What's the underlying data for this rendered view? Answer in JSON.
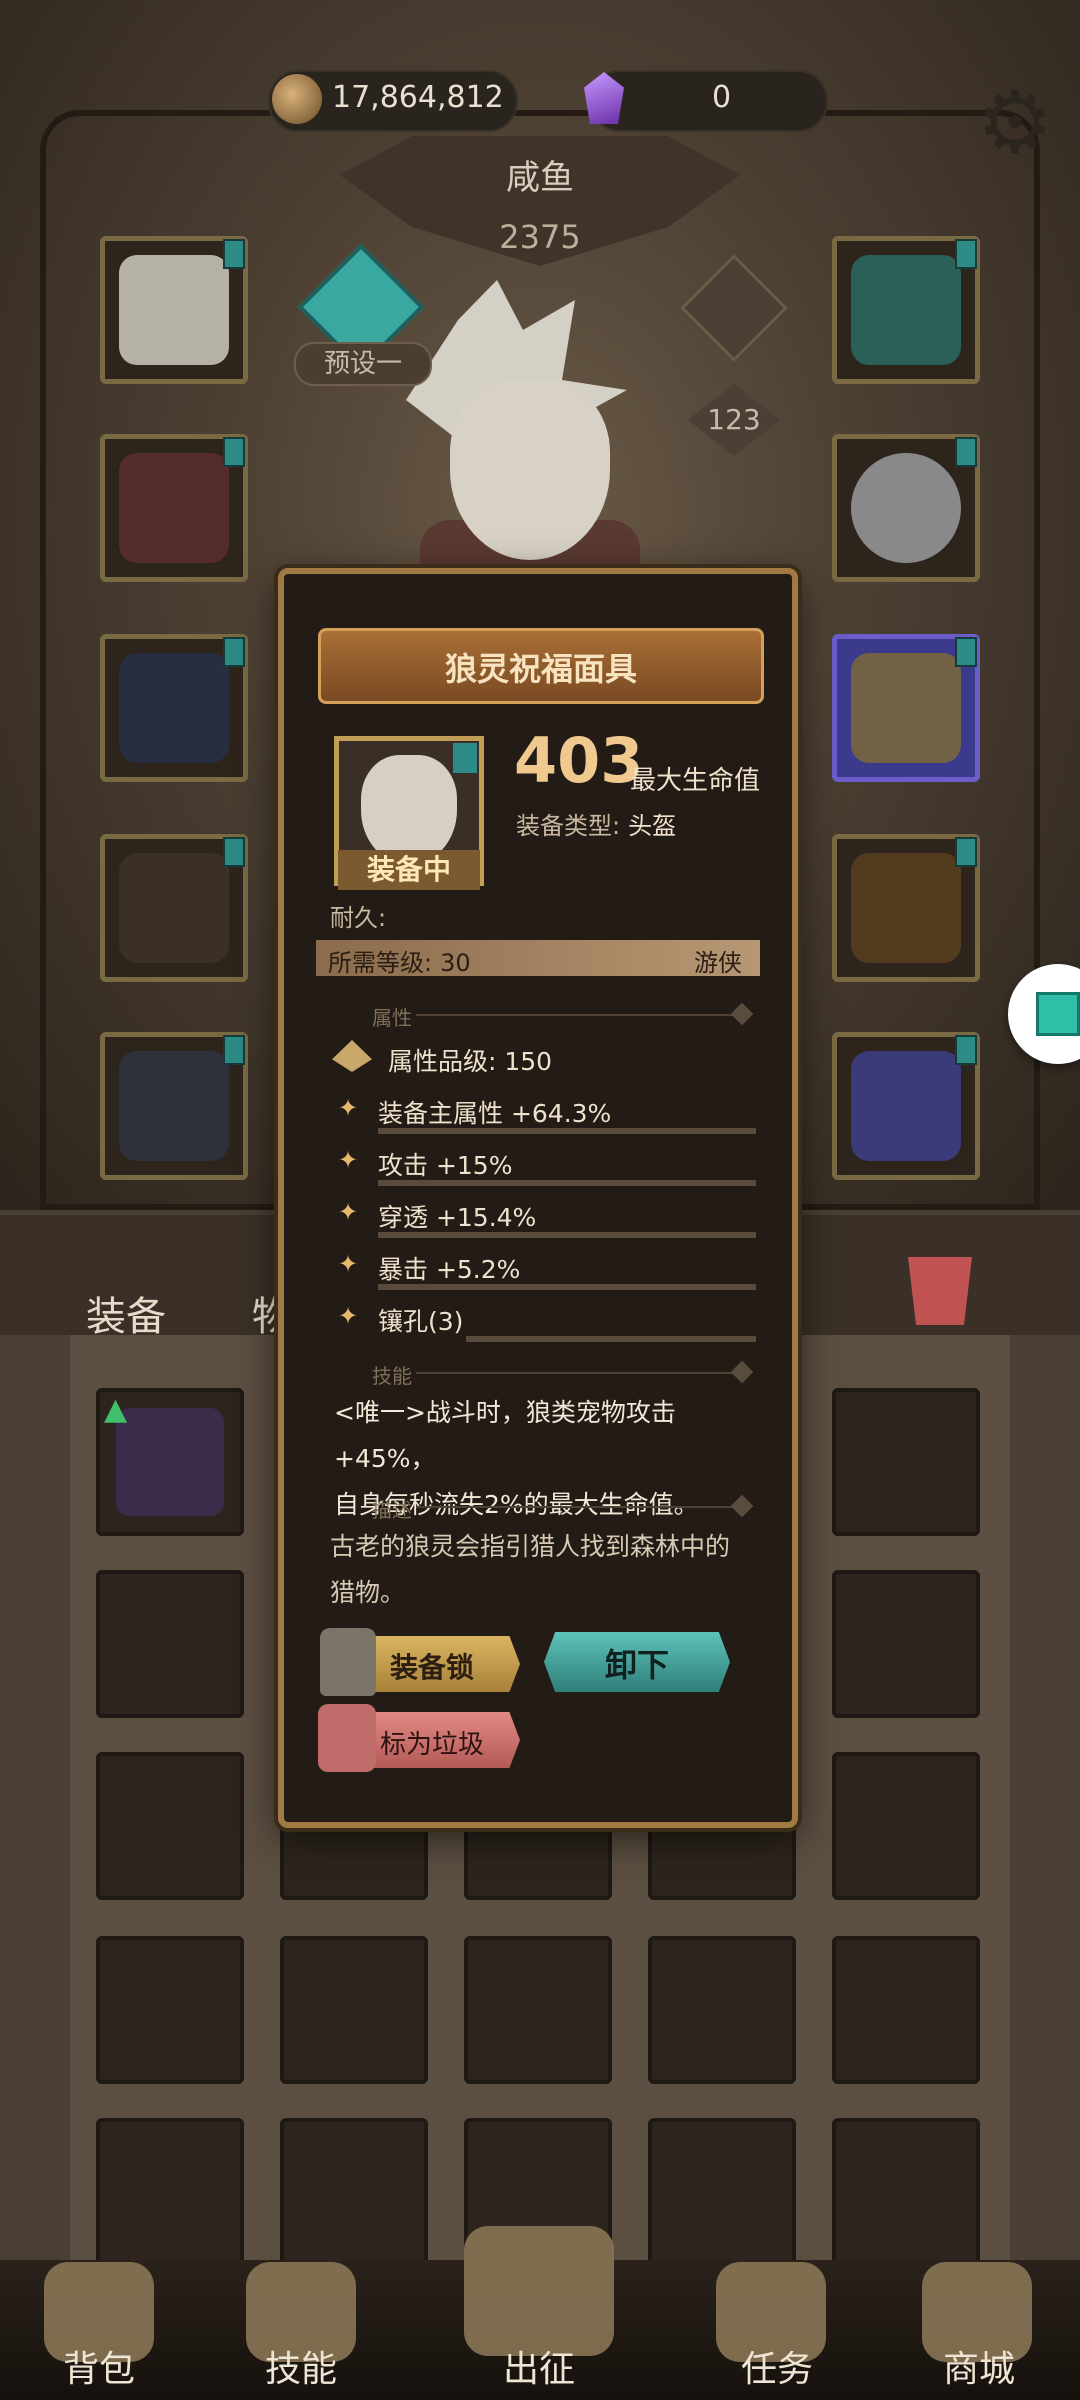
{
  "currency": {
    "gold": "17,864,812",
    "gems": "0"
  },
  "character": {
    "name": "咸鱼",
    "power": "2375",
    "preset_label": "预设一",
    "pet_level": "123"
  },
  "tabs": {
    "equipment": "装备",
    "items": "物品"
  },
  "item": {
    "name": "狼灵祝福面具",
    "stat_value": "403",
    "stat_name": "最大生命值",
    "type_label": "装备类型:",
    "type_value": "头盔",
    "equipped_badge": "装备中",
    "durability_label": "耐久:",
    "required_level_label": "所需等级:",
    "required_level": "30",
    "class": "游侠",
    "section_attributes": "属性",
    "attr_quality": "属性品级: 150",
    "attributes": [
      "装备主属性 +64.3%",
      "攻击 +15%",
      "穿透 +15.4%",
      "暴击 +5.2%",
      "镶孔(3)"
    ],
    "section_skill": "技能",
    "skill_line1": "<唯一>战斗时，狼类宠物攻击+45%，",
    "skill_line2": "自身每秒流失2%的最大生命值。",
    "section_description": "描述",
    "description_line1": "古老的狼灵会指引猎人找到森林中的",
    "description_line2": "猎物。",
    "lock_button": "装备锁",
    "unequip_button": "卸下",
    "junk_button": "标为垃圾"
  },
  "bottom_nav": [
    "背包",
    "技能",
    "出征",
    "任务",
    "商城"
  ],
  "colors": {
    "accent_gold": "#d4a05a",
    "teal": "#3aa8a0",
    "junk_red": "#c06c6a"
  }
}
